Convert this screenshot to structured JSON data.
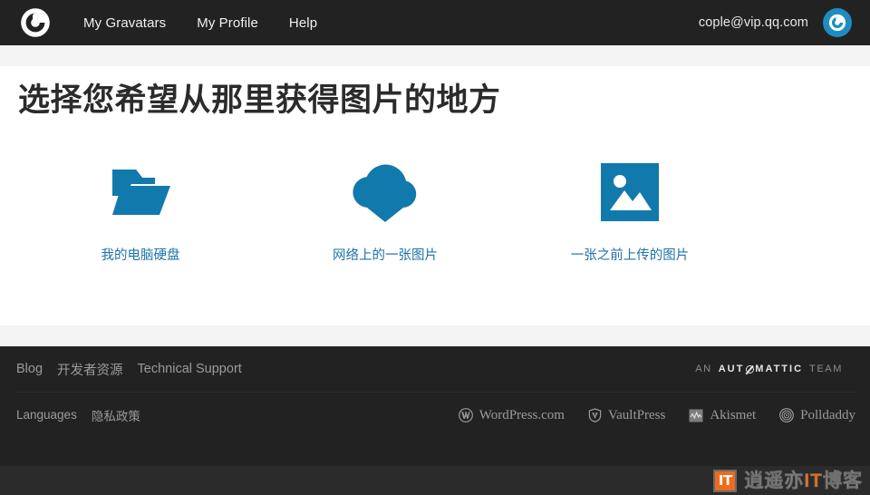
{
  "header": {
    "logo_icon": "gravatar-logo-icon",
    "nav": [
      {
        "label": "My Gravatars"
      },
      {
        "label": "My Profile"
      },
      {
        "label": "Help"
      }
    ],
    "account_email": "cople@vip.qq.com",
    "avatar_icon": "gravatar-avatar-icon",
    "background_color": "#222222",
    "avatar_color": "#1e8cbe"
  },
  "main": {
    "title": "选择您希望从那里获得图片的地方",
    "accent_color": "#1e73a8",
    "choices": [
      {
        "icon": "open-folder-icon",
        "label": "我的电脑硬盘"
      },
      {
        "icon": "cloud-download-icon",
        "label": "网络上的一张图片"
      },
      {
        "icon": "picture-icon",
        "label": "一张之前上传的图片"
      }
    ]
  },
  "footer": {
    "links_row1": [
      {
        "label": "Blog"
      },
      {
        "label": "开发者资源"
      },
      {
        "label": "Technical Support"
      }
    ],
    "links_row2": [
      {
        "label": "Languages"
      },
      {
        "label": "隐私政策"
      }
    ],
    "automattic": {
      "prefix": "AN",
      "word_start": "AUT",
      "word_end": "MATTIC",
      "suffix": "TEAM"
    },
    "brands": [
      {
        "label": "WordPress.com",
        "icon": "wordpress-icon"
      },
      {
        "label": "VaultPress",
        "icon": "vaultpress-shield-icon"
      },
      {
        "label": "Akismet",
        "icon": "akismet-icon"
      },
      {
        "label": "Polldaddy",
        "icon": "polldaddy-icon"
      }
    ]
  },
  "watermark": {
    "badge": "IT",
    "text_before": "逍遥亦",
    "text_accent": "IT",
    "text_after": "博客",
    "accent_color": "#ef6a1b"
  }
}
